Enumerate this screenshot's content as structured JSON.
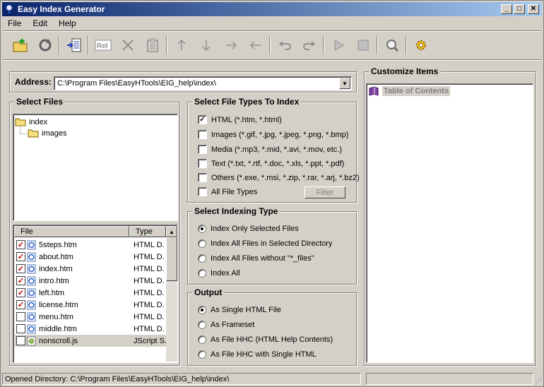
{
  "window": {
    "title": "Easy Index Generator",
    "min": "_",
    "max": "□",
    "close": "✕"
  },
  "menu": [
    "File",
    "Edit",
    "Help"
  ],
  "toolbar": [
    "new-project-icon",
    "refresh-icon",
    "generate-index-icon",
    "rename-icon",
    "delete-icon",
    "paste-icon",
    "move-up-icon",
    "move-down-icon",
    "indent-icon",
    "outdent-icon",
    "undo-icon",
    "redo-icon",
    "play-icon",
    "stop-icon",
    "preview-icon",
    "settings-icon"
  ],
  "address": {
    "label": "Address:",
    "value": "C:\\Program Files\\EasyHTools\\EIG_help\\index\\"
  },
  "select_files": {
    "title": "Select Files",
    "tree": [
      {
        "label": "index"
      },
      {
        "label": "images"
      }
    ],
    "columns": [
      "File",
      "Type"
    ],
    "files": [
      {
        "name": "5steps.htm",
        "type": "HTML D.",
        "checked": true
      },
      {
        "name": "about.htm",
        "type": "HTML D.",
        "checked": true
      },
      {
        "name": "index.htm",
        "type": "HTML D.",
        "checked": true
      },
      {
        "name": "intro.htm",
        "type": "HTML D.",
        "checked": true
      },
      {
        "name": "left.htm",
        "type": "HTML D.",
        "checked": true
      },
      {
        "name": "license.htm",
        "type": "HTML D.",
        "checked": true
      },
      {
        "name": "menu.htm",
        "type": "HTML D.",
        "checked": false
      },
      {
        "name": "middle.htm",
        "type": "HTML D.",
        "checked": false
      },
      {
        "name": "nonscroll.js",
        "type": "JScript S.",
        "checked": false
      }
    ]
  },
  "file_types": {
    "title": "Select File Types To Index",
    "options": [
      {
        "label": "HTML (*.htm, *.html)",
        "checked": true
      },
      {
        "label": "Images (*.gif, *.jpg, *.jpeg, *.png, *.bmp)",
        "checked": false
      },
      {
        "label": "Media (*.mp3, *.mid, *.avi, *.mov, etc.)",
        "checked": false
      },
      {
        "label": "Text (*.txt, *.rtf, *.doc, *.xls, *.ppt, *.pdf)",
        "checked": false
      },
      {
        "label": "Others (*.exe, *.msi, *.zip, *.rar, *.arj, *.bz2)",
        "checked": false
      },
      {
        "label": "All File Types",
        "checked": false
      }
    ],
    "filter_button": "Filter"
  },
  "indexing_type": {
    "title": "Select Indexing Type",
    "options": [
      "Index Only Selected Files",
      "Index All Files in Selected Directory",
      "Index All Files without \"*_files\"",
      "Index All"
    ],
    "selected": 0
  },
  "output": {
    "title": "Output",
    "options": [
      "As Single HTML File",
      "As Frameset",
      "As File HHC (HTML Help Contents)",
      "As File HHC with Single HTML"
    ],
    "selected": 0
  },
  "customize": {
    "title": "Customize Items",
    "items": [
      "Table of Contents"
    ]
  },
  "status": {
    "text": "Opened Directory: C:\\Program Files\\EasyHTools\\EIG_help\\index\\"
  },
  "colors": {
    "title_start": "#0a246a",
    "title_end": "#a6caf0",
    "selection": "#d4d0c8",
    "check": "#c00000"
  }
}
